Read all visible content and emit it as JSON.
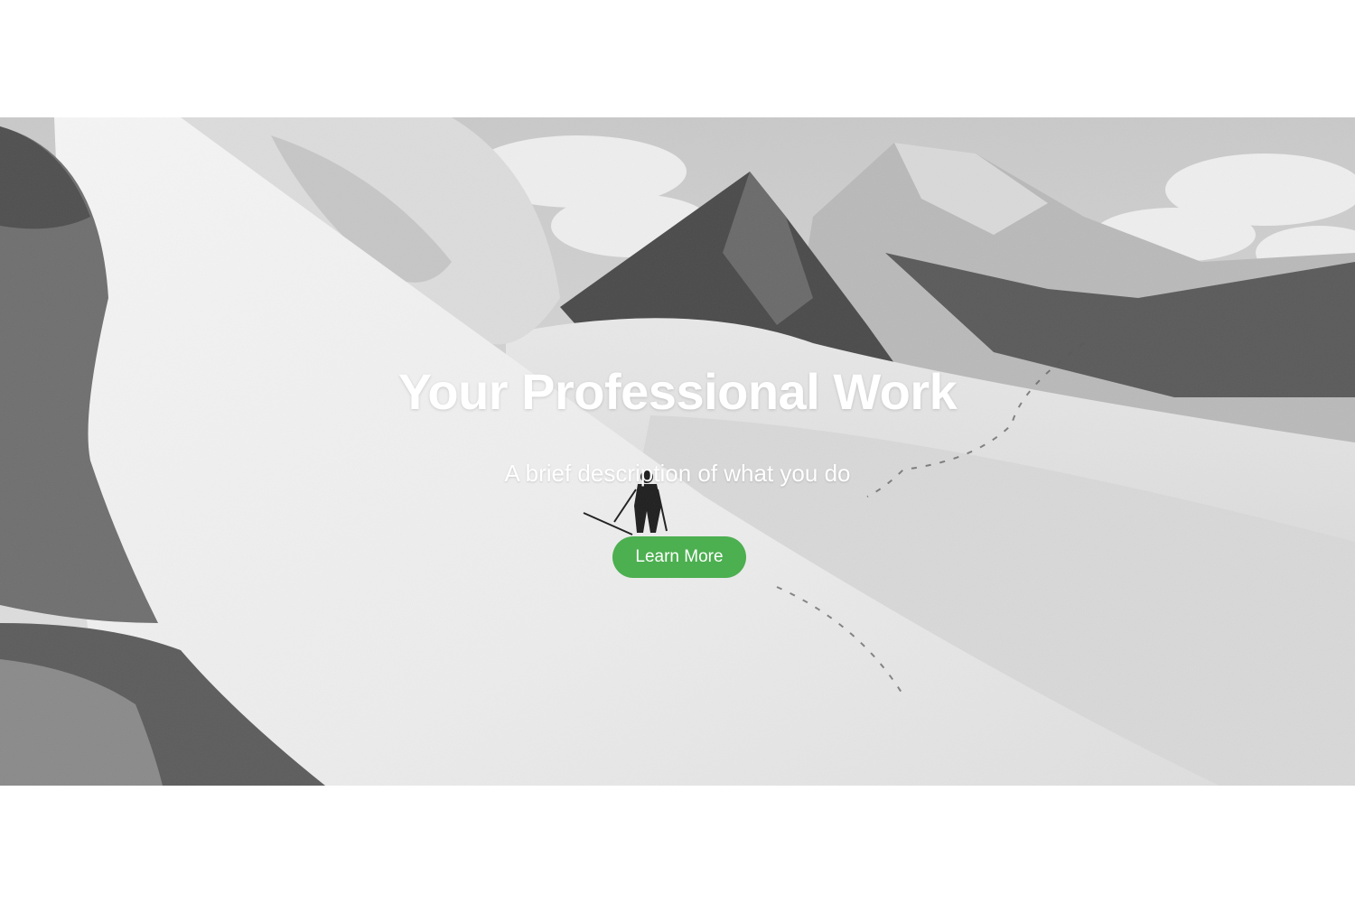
{
  "hero": {
    "title": "Your Professional Work",
    "subtitle": "A brief description of what you do",
    "cta_label": "Learn More",
    "background_image": "black-and-white snowy mountain ski-touring scene",
    "colors": {
      "cta_background": "#4caf50",
      "text": "#ffffff",
      "page_background": "#ffffff"
    }
  }
}
